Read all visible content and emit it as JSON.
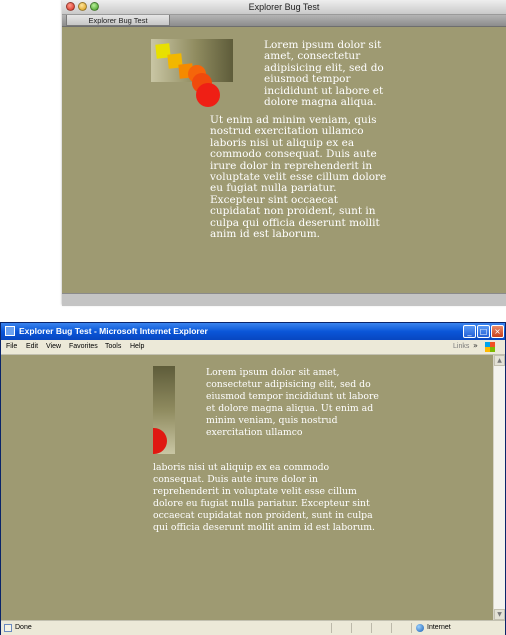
{
  "mac_window": {
    "title": "Explorer Bug Test",
    "tab_label": "Explorer Bug Test",
    "colors": {
      "page_bg": "#9e9a72",
      "text": "#ffffff"
    },
    "squares": [
      {
        "color": "#e8e000"
      },
      {
        "color": "#f2b700"
      },
      {
        "color": "#f58a00"
      }
    ],
    "circles": [
      {
        "color": "#f5650a"
      },
      {
        "color": "#f04a0c"
      },
      {
        "color": "#ef1f15"
      }
    ]
  },
  "ie_window": {
    "title": "Explorer Bug Test - Microsoft Internet Explorer",
    "menu": [
      "File",
      "Edit",
      "View",
      "Favorites",
      "Tools",
      "Help"
    ],
    "links_label": "Links",
    "chevron": "»",
    "status_text": "Done",
    "zone_text": "Internet",
    "circle_color": "#e01812"
  },
  "content": {
    "paragraph_top_mac": "Lorem ipsum dolor sit amet, consectetur adipisicing elit, sed do eiusmod tempor incididunt ut labore et dolore magna aliqua.",
    "paragraph_bottom_mac": "Ut enim ad minim veniam, quis nostrud exercitation ullamco laboris nisi ut aliquip ex ea commodo consequat. Duis aute irure dolor in reprehenderit in voluptate velit esse cillum dolore eu fugiat nulla pariatur. Excepteur sint occaecat cupidatat non proident, sunt in culpa qui officia deserunt mollit anim id est laborum.",
    "paragraph_top_ie": "Lorem ipsum dolor sit amet, consectetur adipisicing elit, sed do eiusmod tempor incididunt ut labore et dolore magna aliqua. Ut enim ad minim veniam, quis nostrud exercitation ullamco",
    "paragraph_bottom_ie": "laboris nisi ut aliquip ex ea commodo consequat. Duis aute irure dolor in reprehenderit in voluptate velit esse cillum dolore eu fugiat nulla pariatur. Excepteur sint occaecat cupidatat non proident, sunt in culpa qui officia deserunt mollit anim id est laborum."
  }
}
